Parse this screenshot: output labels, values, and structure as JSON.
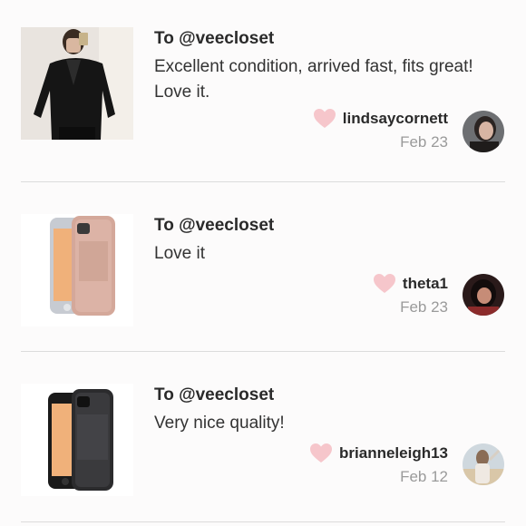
{
  "reviews": [
    {
      "to": "To @veecloset",
      "message": "Excellent condition, arrived fast, fits great! Love it.",
      "username": "lindsaycornett",
      "date": "Feb 23",
      "product_icon": "leather-jacket-photo",
      "avatar_icon": "user-avatar-photo"
    },
    {
      "to": "To @veecloset",
      "message": "Love it",
      "username": "theta1",
      "date": "Feb 23",
      "product_icon": "rose-gold-phone-case-photo",
      "avatar_icon": "user-avatar-photo"
    },
    {
      "to": "To @veecloset",
      "message": "Very nice quality!",
      "username": "brianneleigh13",
      "date": "Feb 12",
      "product_icon": "black-phone-case-photo",
      "avatar_icon": "user-avatar-photo"
    }
  ],
  "colors": {
    "heart": "#f6c6cb",
    "text": "#2a2a2a",
    "muted": "#9a9a9a",
    "divider": "#dcdcdc"
  }
}
